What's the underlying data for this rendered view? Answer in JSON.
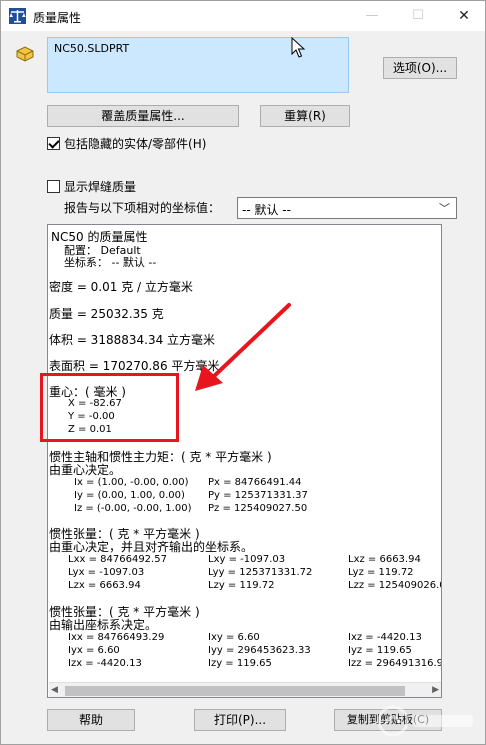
{
  "window": {
    "title": "质量属性",
    "min_symbol": "—",
    "max_symbol": "☐",
    "close_symbol": "✕"
  },
  "selection": {
    "items": [
      "NC50.SLDPRT"
    ]
  },
  "buttons": {
    "options": "选项(O)...",
    "override": "覆盖质量属性...",
    "recalc": "重算(R)",
    "help": "帮助",
    "print": "打印(P)...",
    "copy": "复制到剪贴板(C)"
  },
  "checkboxes": {
    "include_hidden": {
      "label": "包括隐藏的实体/零部件(H)",
      "checked": true
    },
    "show_weld": {
      "label": "显示焊缝质量",
      "checked": false
    }
  },
  "coord": {
    "label": "报告与以下项相对的坐标值：",
    "selected": "-- 默认 --"
  },
  "results": {
    "header": "NC50 的质量属性",
    "config": "配置： Default",
    "coord_sys": "坐标系： -- 默认 --",
    "density": "密度 = 0.01 克 / 立方毫米",
    "mass": "质量 = 25032.35 克",
    "volume": "体积 = 3188834.34 立方毫米",
    "surface_area": "表面积 = 170270.86  平方毫米",
    "cog_title": "重心：( 毫米 )",
    "cog_x": "X = -82.67",
    "cog_y": "Y = -0.00",
    "cog_z": "Z = 0.01",
    "principal_title": "惯性主轴和惯性主力矩：( 克 *  平方毫米 )",
    "principal_sub": "由重心决定。",
    "principal_rows": [
      {
        "axis": "Ix = (1.00, -0.00, 0.00)",
        "moment": "Px = 84766491.44"
      },
      {
        "axis": "Iy = (0.00, 1.00, 0.00)",
        "moment": "Py = 125371331.37"
      },
      {
        "axis": "Iz = (-0.00, -0.00, 1.00)",
        "moment": "Pz = 125409027.50"
      }
    ],
    "tensor1_title": "惯性张量：( 克 *  平方毫米 )",
    "tensor1_sub": "由重心决定，并且对齐输出的坐标系。",
    "tensor1_rows": [
      [
        "Lxx = 84766492.57",
        "Lxy = -1097.03",
        "Lxz = 6663.94"
      ],
      [
        "Lyx = -1097.03",
        "Lyy = 125371331.72",
        "Lyz = 119.72"
      ],
      [
        "Lzx = 6663.94",
        "Lzy = 119.72",
        "Lzz = 125409026.0"
      ]
    ],
    "tensor2_title": "惯性张量：( 克 *  平方毫米 )",
    "tensor2_sub": "由输出座标系决定。",
    "tensor2_rows": [
      [
        "Ixx = 84766493.29",
        "Ixy = 6.60",
        "Ixz = -4420.13"
      ],
      [
        "Iyx = 6.60",
        "Iyy = 296453623.33",
        "Iyz = 119.65"
      ],
      [
        "Izx = -4420.13",
        "Izy = 119.65",
        "Izz = 296491316.9"
      ]
    ]
  },
  "colors": {
    "annotation_red": "#e8151d",
    "selection_bg": "#cce8ff"
  }
}
